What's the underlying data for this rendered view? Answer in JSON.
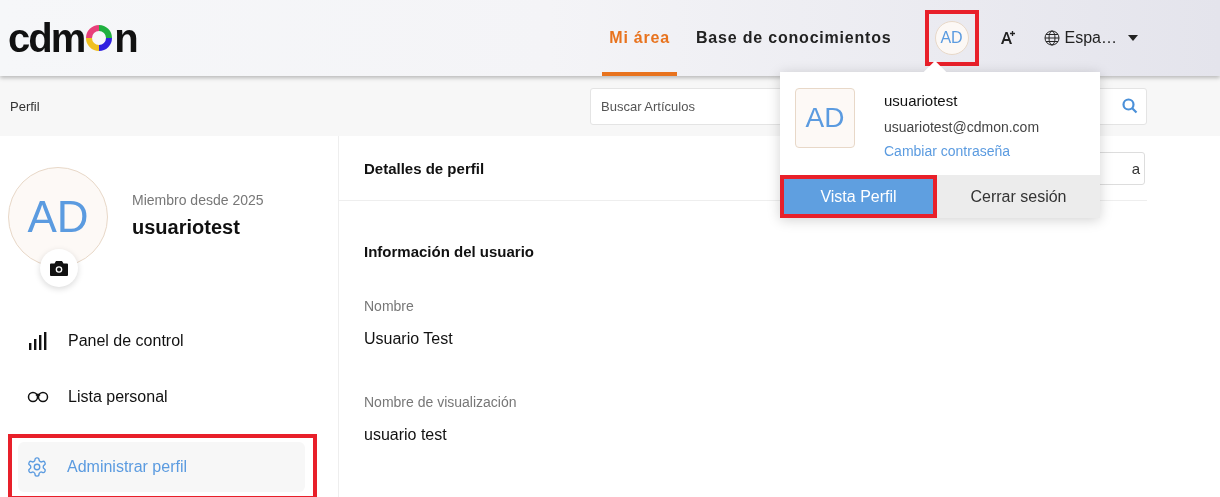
{
  "header": {
    "logo": [
      "cdm",
      "n"
    ],
    "nav": [
      {
        "label": "Mi área",
        "selected": true
      },
      {
        "label": "Base de conocimientos",
        "selected": false
      }
    ],
    "avatar": {
      "initials": "AD",
      "highlighted": true
    },
    "language": {
      "label": "Espa…"
    }
  },
  "subheader": {
    "breadcrumb": "Perfil",
    "search": {
      "placeholder": "Buscar Artículos"
    }
  },
  "sidebar": {
    "avatar": {
      "initials": "AD"
    },
    "member_since": "Miembro desde 2025",
    "username": "usuariotest",
    "items": [
      {
        "kind": "chart",
        "label": "Panel de control",
        "selected": false,
        "highlighted": false
      },
      {
        "kind": "glasses",
        "label": "Lista personal",
        "selected": false,
        "highlighted": false
      },
      {
        "kind": "gear",
        "label": "Administrar perfil",
        "selected": true,
        "highlighted": true
      }
    ]
  },
  "main": {
    "title": "Detalles de perfil",
    "header_button": "a",
    "section": "Información del usuario",
    "fields": [
      {
        "label": "Nombre",
        "value": "Usuario Test"
      },
      {
        "label": "Nombre de visualización",
        "value": "usuario test"
      }
    ]
  },
  "dropdown": {
    "initials": "AD",
    "username": "usuariotest",
    "email": "usuariotest@cdmon.com",
    "link": "Cambiar contraseña",
    "buttons": [
      {
        "kind": "primary",
        "label": "Vista Perfil",
        "highlighted": true
      },
      {
        "kind": "secondary",
        "label": "Cerrar sesión",
        "highlighted": false
      }
    ]
  }
}
